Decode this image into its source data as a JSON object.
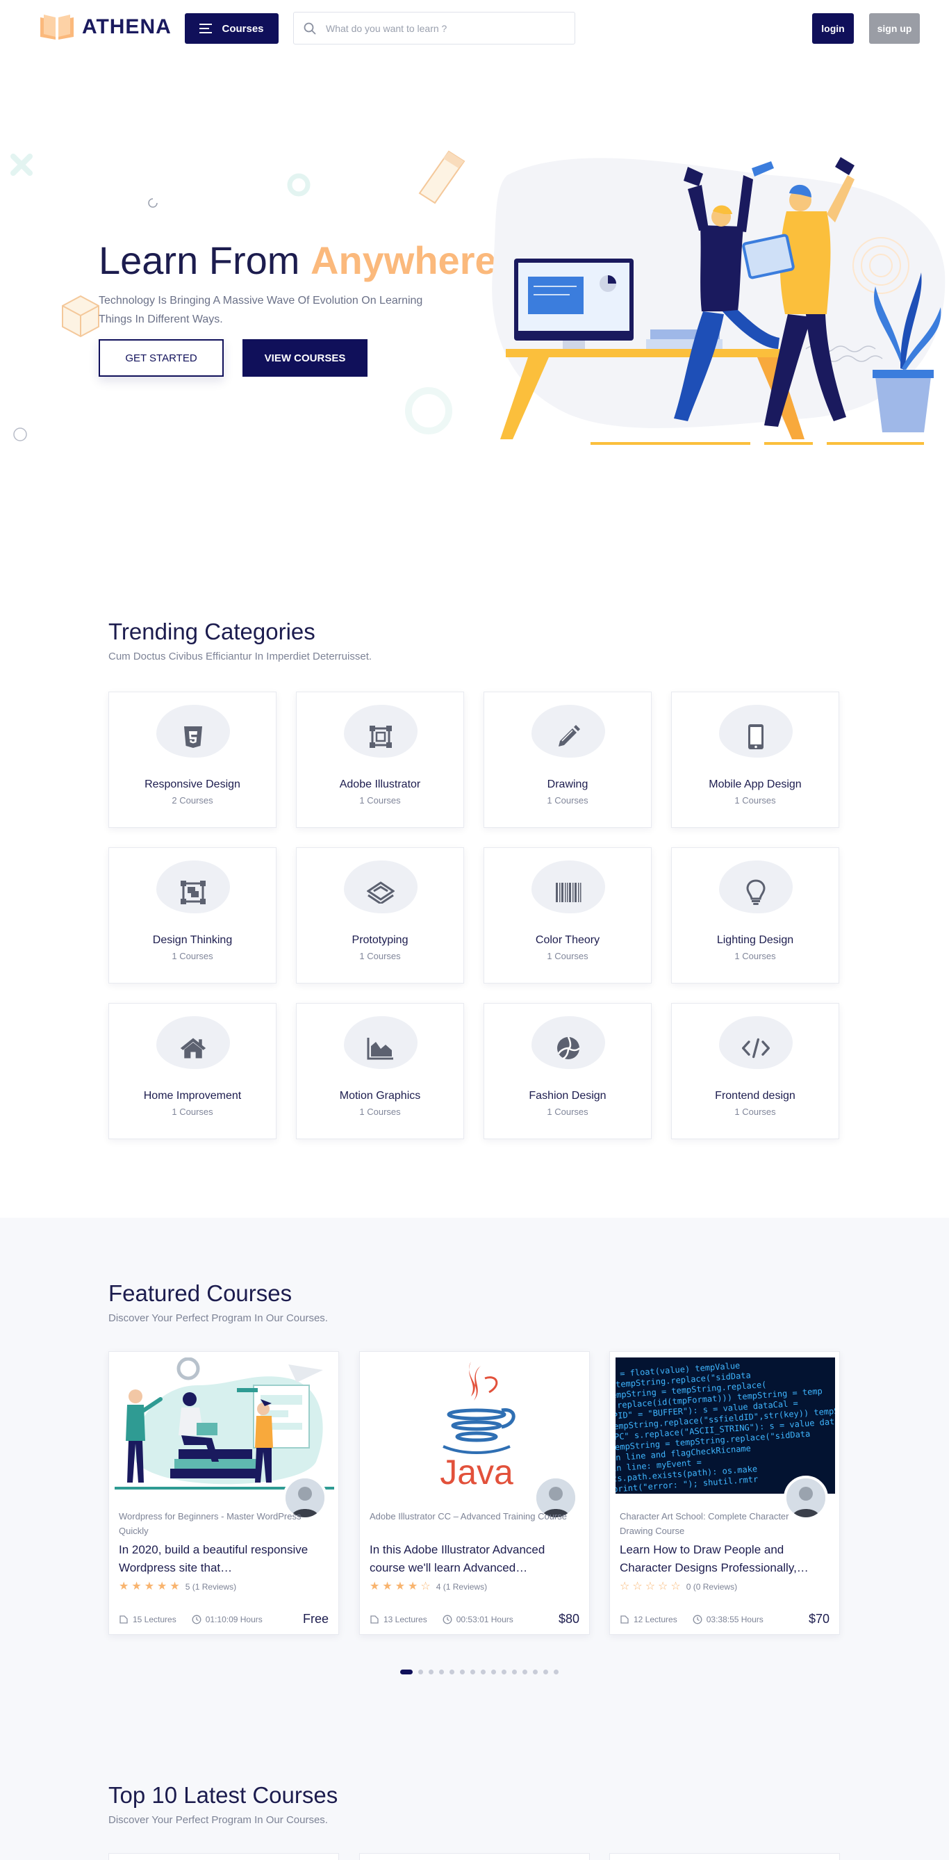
{
  "header": {
    "logo_text": "ATHENA",
    "courses_label": "Courses",
    "search_placeholder": "What do you want to learn ?",
    "login_label": "login",
    "signup_label": "sign up"
  },
  "hero": {
    "title_prefix": "Learn From ",
    "title_highlight": "Anywhere",
    "subtitle": "Technology Is Bringing A Massive Wave Of Evolution On Learning Things In Different Ways.",
    "primary_button": "GET STARTED",
    "secondary_button": "VIEW COURSES"
  },
  "trending": {
    "title": "Trending Categories",
    "subtitle": "Cum Doctus Civibus Efficiantur In Imperdiet Deterruisset.",
    "categories": [
      {
        "name": "Responsive Design",
        "count": "2 Courses",
        "icon": "css3-icon"
      },
      {
        "name": "Adobe Illustrator",
        "count": "1 Courses",
        "icon": "vector-icon"
      },
      {
        "name": "Drawing",
        "count": "1 Courses",
        "icon": "pencil-icon"
      },
      {
        "name": "Mobile App Design",
        "count": "1 Courses",
        "icon": "mobile-icon"
      },
      {
        "name": "Design Thinking",
        "count": "1 Courses",
        "icon": "object-group-icon"
      },
      {
        "name": "Prototyping",
        "count": "1 Courses",
        "icon": "layers-icon"
      },
      {
        "name": "Color Theory",
        "count": "1 Courses",
        "icon": "barcode-icon"
      },
      {
        "name": "Lighting Design",
        "count": "1 Courses",
        "icon": "lightbulb-icon"
      },
      {
        "name": "Home Improvement",
        "count": "1 Courses",
        "icon": "home-icon"
      },
      {
        "name": "Motion Graphics",
        "count": "1 Courses",
        "icon": "chart-area-icon"
      },
      {
        "name": "Fashion Design",
        "count": "1 Courses",
        "icon": "volleyball-icon"
      },
      {
        "name": "Frontend design",
        "count": "1 Courses",
        "icon": "code-icon"
      }
    ]
  },
  "featured": {
    "title": "Featured Courses",
    "subtitle": "Discover Your Perfect Program In Our Courses.",
    "courses": [
      {
        "category": "Wordpress for Beginners - Master WordPress Quickly",
        "title": "In 2020, build a beautiful responsive Wordpress site that…",
        "stars": 5,
        "reviews": "5 (1 Reviews)",
        "lectures": "15 Lectures",
        "duration": "01:10:09 Hours",
        "price": "Free",
        "image": "wordpress-illustration"
      },
      {
        "category": "Adobe Illustrator CC – Advanced Training Course",
        "title": "In this Adobe Illustrator Advanced course we'll learn Advanced…",
        "stars": 4,
        "reviews": "4 (1 Reviews)",
        "lectures": "13 Lectures",
        "duration": "00:53:01 Hours",
        "price": "$80",
        "image": "java-logo",
        "image_text": "Java"
      },
      {
        "category": "Character Art School: Complete Character Drawing Course",
        "title": "Learn How to Draw People and Character Designs Professionally,…",
        "stars": 0,
        "reviews": "0 (0 Reviews)",
        "lectures": "12 Lectures",
        "duration": "03:38:55 Hours",
        "price": "$70",
        "image": "code-screen",
        "code_lines": [
          "ue = float(value) tempValue",
          "+ tempString.replace(\"sidData",
          "tempString = tempString.replace(",
          "e.replace(id(tmpFormat))) tempString = temp",
          "OPID\" = \"BUFFER\"): s = value dataCal =",
          "tempString.replace(\"ssfieldID\",str(key)) tempStri",
          "PPC\" s.replace(\"ASCII_STRING\"): s = value dataCal",
          "tempString = tempString.replace(\"sidData",
          "in line and flagCheckRicname",
          "in line: myEvent =",
          "ts.path.exists(path): os.make",
          "print(\"error: \"); shutil.rmtr"
        ]
      }
    ],
    "carousel_pages": 15,
    "carousel_active": 0
  },
  "latest": {
    "title": "Top 10 Latest Courses",
    "subtitle": "Discover Your Perfect Program In Our Courses."
  },
  "colors": {
    "navy": "#10105a",
    "accent": "#fbb97c",
    "star": "#f8b46f",
    "muted": "#7d8396"
  }
}
